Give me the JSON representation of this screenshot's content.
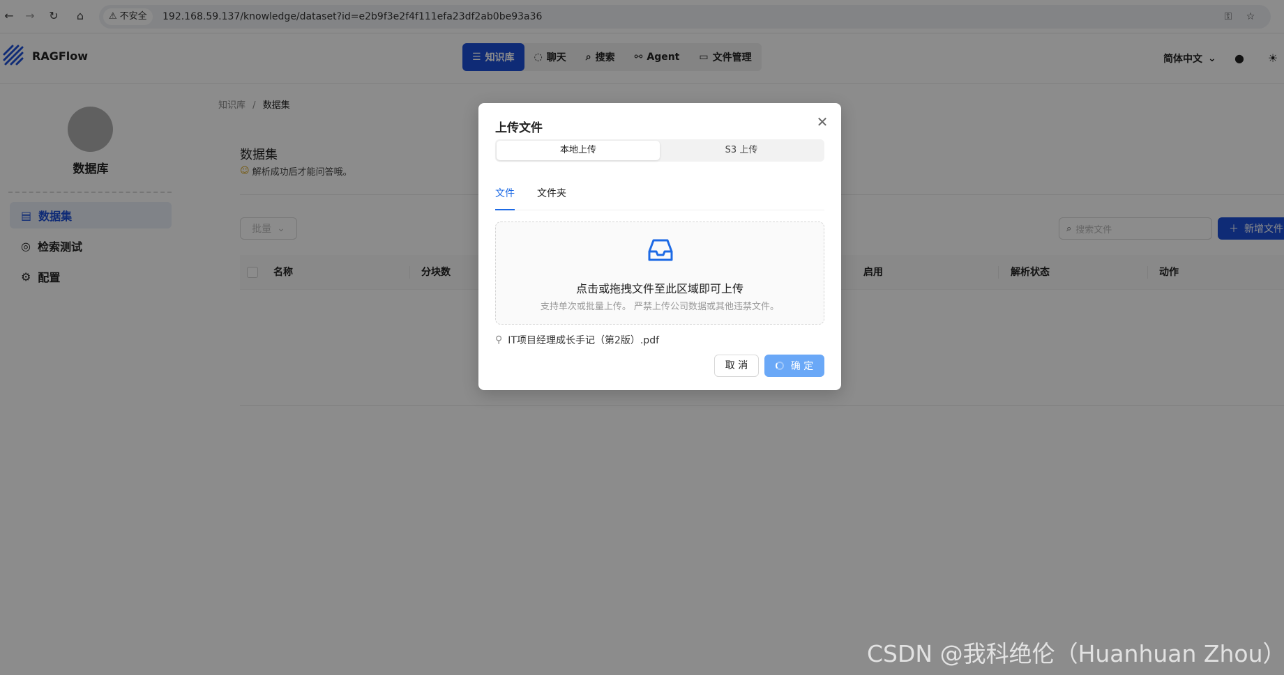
{
  "browser": {
    "url_prefix": "不安全",
    "url": "192.168.59.137/knowledge/dataset?id=e2b9f3e2f4f111efa23df2ab0be93a36",
    "icons": [
      "back-icon",
      "forward-icon",
      "reload-icon",
      "home-icon",
      "key-icon",
      "star-icon"
    ]
  },
  "header": {
    "app_name": "RAGFlow",
    "nav": [
      {
        "label": "知识库",
        "icon": "database-icon"
      },
      {
        "label": "聊天",
        "icon": "chat-icon"
      },
      {
        "label": "搜索",
        "icon": "search-icon"
      },
      {
        "label": "Agent",
        "icon": "agent-icon"
      },
      {
        "label": "文件管理",
        "icon": "folder-icon"
      }
    ],
    "language": "简体中文",
    "accent_color": "#1d4fd8"
  },
  "sidebar": {
    "kb_name": "数据库",
    "items": [
      {
        "label": "数据集",
        "icon": "file-text-icon"
      },
      {
        "label": "检索测试",
        "icon": "target-icon"
      },
      {
        "label": "配置",
        "icon": "gear-icon"
      }
    ]
  },
  "main": {
    "breadcrumb": {
      "parent": "知识库",
      "separator": "/",
      "current": "数据集"
    },
    "title": "数据集",
    "tip": "解析成功后才能问答哦。",
    "batch_label": "批量",
    "search_placeholder": "搜索文件",
    "new_file_label": "新增文件",
    "columns": [
      "名称",
      "分块数",
      "启用",
      "解析状态",
      "动作"
    ]
  },
  "modal": {
    "title": "上传文件",
    "segments": [
      "本地上传",
      "S3 上传"
    ],
    "tabs": [
      "文件",
      "文件夹"
    ],
    "drop_text": "点击或拖拽文件至此区域即可上传",
    "drop_hint": "支持单次或批量上传。 严禁上传公司数据或其他违禁文件。",
    "file_name": "IT项目经理成长手记（第2版）.pdf",
    "cancel_label": "取 消",
    "ok_label": "确 定"
  },
  "watermark": "CSDN @我科绝伦（Huanhuan Zhou）"
}
